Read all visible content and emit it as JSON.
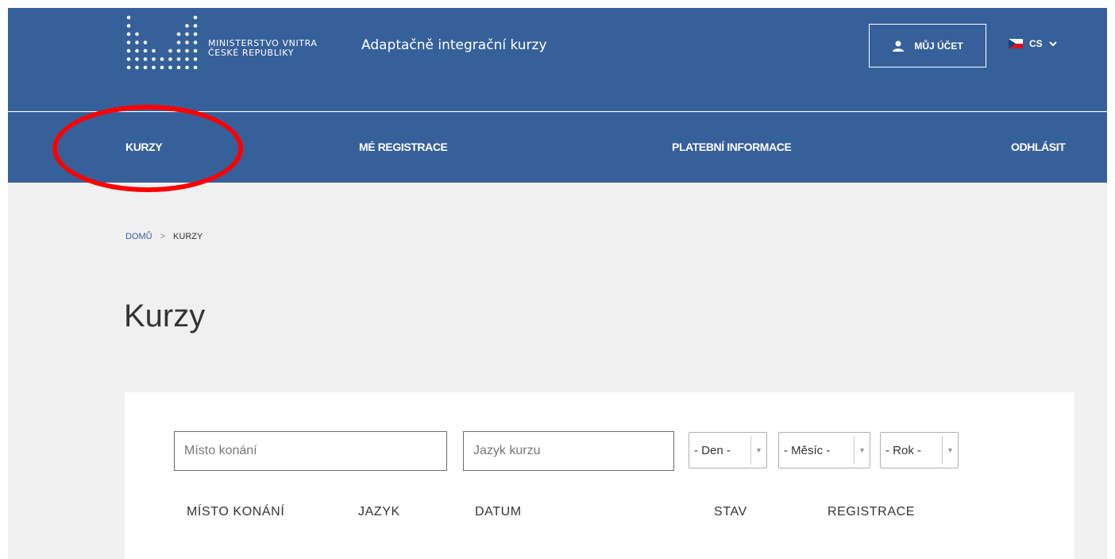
{
  "header": {
    "ministry_line1": "MINISTERSTVO VNITRA",
    "ministry_line2": "ČESKÉ REPUBLIKY",
    "app_title": "Adaptačně integrační kurzy",
    "account_label": "MŮJ ÚČET",
    "account_icon": "user-icon",
    "language": "CS",
    "flag": "czech-flag"
  },
  "nav": {
    "items": [
      "KURZY",
      "MÉ REGISTRACE",
      "PLATEBNÍ INFORMACE",
      "ODHLÁSIT"
    ]
  },
  "breadcrumb": {
    "home": "DOMŮ",
    "separator": ">",
    "current": "KURZY"
  },
  "page": {
    "title": "Kurzy"
  },
  "filters": {
    "place_placeholder": "Místo konání",
    "language_placeholder": "Jazyk kurzu",
    "day": "- Den -",
    "month": "- Měsíc -",
    "year": "- Rok -"
  },
  "table": {
    "columns": [
      "MÍSTO KONÁNÍ",
      "JAZYK",
      "DATUM",
      "STAV",
      "REGISTRACE"
    ]
  },
  "colors": {
    "primary": "#36609a",
    "highlight": "#ff0000",
    "background": "#f0f0f0"
  }
}
